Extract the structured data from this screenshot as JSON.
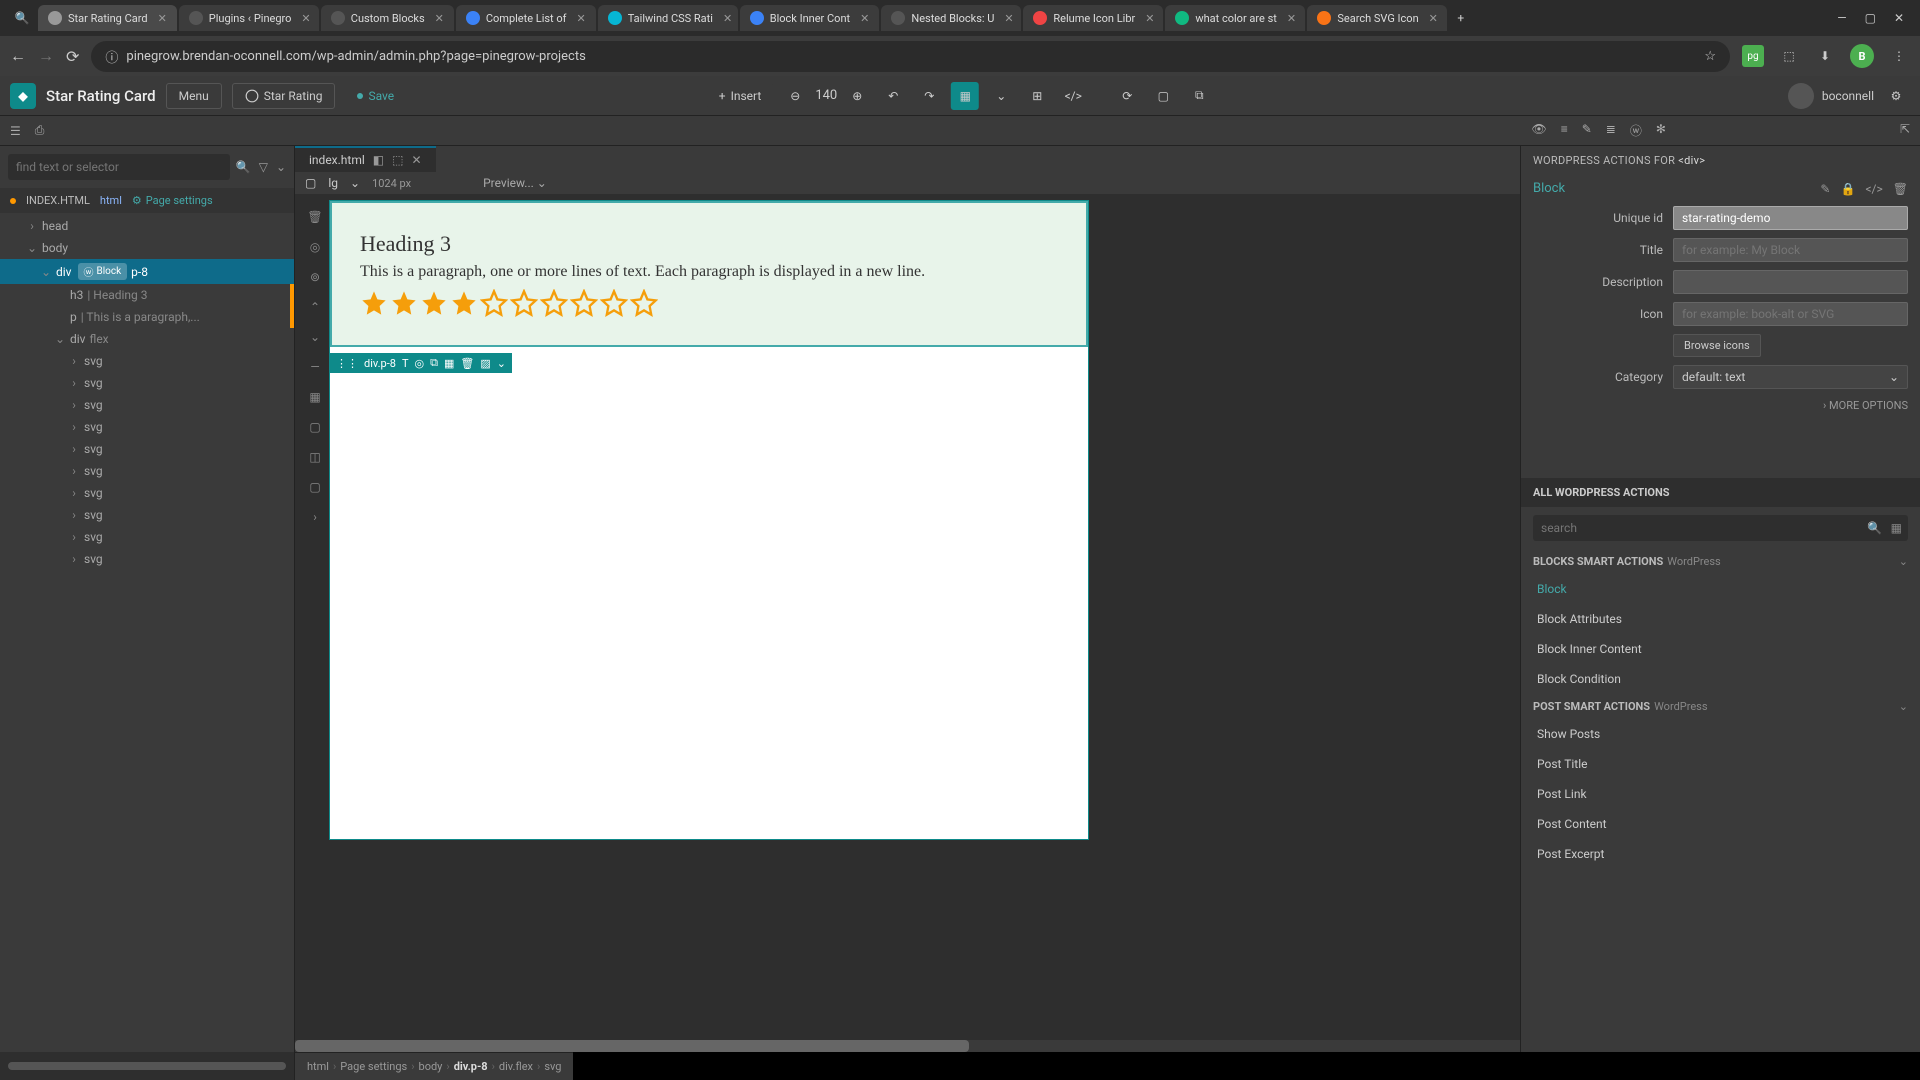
{
  "browser": {
    "tabs": [
      {
        "title": "Star Rating Card",
        "favicon": "#999",
        "active": true
      },
      {
        "title": "Plugins ‹ Pinegro",
        "favicon": "#555"
      },
      {
        "title": "Custom Blocks",
        "favicon": "#555"
      },
      {
        "title": "Complete List of",
        "favicon": "#3b82f6"
      },
      {
        "title": "Tailwind CSS Rati",
        "favicon": "#06b6d4"
      },
      {
        "title": "Block Inner Cont",
        "favicon": "#3b82f6"
      },
      {
        "title": "Nested Blocks: U",
        "favicon": "#555"
      },
      {
        "title": "Relume Icon Libr",
        "favicon": "#ef4444"
      },
      {
        "title": "what color are st",
        "favicon": "#10b981"
      },
      {
        "title": "Search SVG Icon",
        "favicon": "#f97316"
      }
    ],
    "url": "pinegrow.brendan-oconnell.com/wp-admin/admin.php?page=pinegrow-projects",
    "avatar": "B"
  },
  "app": {
    "project": "Star Rating Card",
    "menu": "Menu",
    "star_rating": "Star Rating",
    "save": "Save",
    "insert": "Insert",
    "zoom": "140",
    "user": "boconnell"
  },
  "leftPanel": {
    "search_placeholder": "find text or selector",
    "file_label": "INDEX.HTML",
    "html_text": "html",
    "page_settings": "Page settings",
    "tree": [
      {
        "tag": "head",
        "indent": 1,
        "arrow": "›"
      },
      {
        "tag": "body",
        "indent": 1,
        "arrow": "⌄"
      },
      {
        "tag": "div",
        "indent": 2,
        "arrow": "⌄",
        "block": "Block",
        "extra": "p-8",
        "selected": true
      },
      {
        "tag": "h3",
        "indent": 3,
        "extra": "| Heading 3",
        "orange": true
      },
      {
        "tag": "p",
        "indent": 3,
        "extra": "| This is a paragraph,...",
        "orange": true
      },
      {
        "tag": "div",
        "indent": 3,
        "arrow": "⌄",
        "extra": "flex"
      },
      {
        "tag": "svg",
        "indent": 4,
        "arrow": "›"
      },
      {
        "tag": "svg",
        "indent": 4,
        "arrow": "›"
      },
      {
        "tag": "svg",
        "indent": 4,
        "arrow": "›"
      },
      {
        "tag": "svg",
        "indent": 4,
        "arrow": "›"
      },
      {
        "tag": "svg",
        "indent": 4,
        "arrow": "›"
      },
      {
        "tag": "svg",
        "indent": 4,
        "arrow": "›"
      },
      {
        "tag": "svg",
        "indent": 4,
        "arrow": "›"
      },
      {
        "tag": "svg",
        "indent": 4,
        "arrow": "›"
      },
      {
        "tag": "svg",
        "indent": 4,
        "arrow": "›"
      },
      {
        "tag": "svg",
        "indent": 4,
        "arrow": "›"
      }
    ]
  },
  "canvas": {
    "file_tab": "index.html",
    "breakpoint": "lg",
    "width": "1024 px",
    "preview": "Preview...",
    "h3": "Heading 3",
    "p": "This is a paragraph, one or more lines of text. Each paragraph is displayed in a new line.",
    "stars_filled": 4,
    "stars_total": 10,
    "selection_label": "div.p-8"
  },
  "rightPanel": {
    "header_prefix": "WORDPRESS ACTIONS FOR",
    "header_tag": "<div>",
    "block_label": "Block",
    "fields": {
      "unique_id": {
        "label": "Unique id",
        "value": "star-rating-demo"
      },
      "title": {
        "label": "Title",
        "placeholder": "for example: My Block"
      },
      "description": {
        "label": "Description"
      },
      "icon": {
        "label": "Icon",
        "placeholder": "for example: book-alt or SVG"
      },
      "browse": "Browse icons",
      "category": {
        "label": "Category",
        "value": "default: text"
      }
    },
    "more": "MORE OPTIONS",
    "all_actions": "ALL WORDPRESS ACTIONS",
    "search_placeholder": "search",
    "sections": [
      {
        "title": "BLOCKS SMART ACTIONS",
        "sub": "WordPress",
        "items": [
          "Block",
          "Block Attributes",
          "Block Inner Content",
          "Block Condition"
        ]
      },
      {
        "title": "POST SMART ACTIONS",
        "sub": "WordPress",
        "items": [
          "Show Posts",
          "Post Title",
          "Post Link",
          "Post Content",
          "Post Excerpt"
        ]
      }
    ]
  },
  "breadcrumb": [
    "html",
    "Page settings",
    "body",
    "div.p-8",
    "div.flex",
    "svg"
  ]
}
